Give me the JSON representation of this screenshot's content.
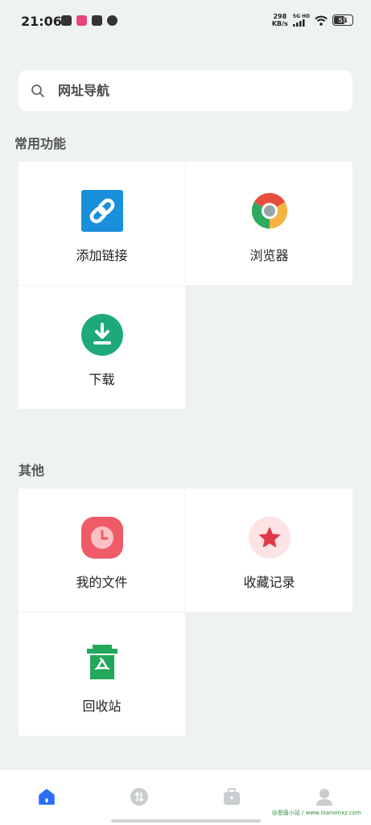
{
  "status_bar": {
    "time": "21:06",
    "net_speed_value": "298",
    "net_speed_unit": "KB/s",
    "signal_label": "5G HD",
    "battery": "55"
  },
  "search": {
    "placeholder": "网址导航"
  },
  "sections": [
    {
      "title": "常用功能",
      "items": [
        {
          "label": "添加链接",
          "icon": "link-icon"
        },
        {
          "label": "浏览器",
          "icon": "chrome-icon"
        },
        {
          "label": "下载",
          "icon": "download-icon"
        }
      ]
    },
    {
      "title": "其他",
      "items": [
        {
          "label": "我的文件",
          "icon": "clock-icon"
        },
        {
          "label": "收藏记录",
          "icon": "star-icon"
        },
        {
          "label": "回收站",
          "icon": "recycle-bin-icon"
        }
      ]
    }
  ],
  "bottom_nav": [
    "home-icon",
    "transfer-icon",
    "toolbox-icon",
    "profile-icon"
  ],
  "watermark": "@悲唐小站 / www.nianxinxz.com",
  "colors": {
    "accent": "#2a6df4",
    "background": "#eef2f2"
  }
}
